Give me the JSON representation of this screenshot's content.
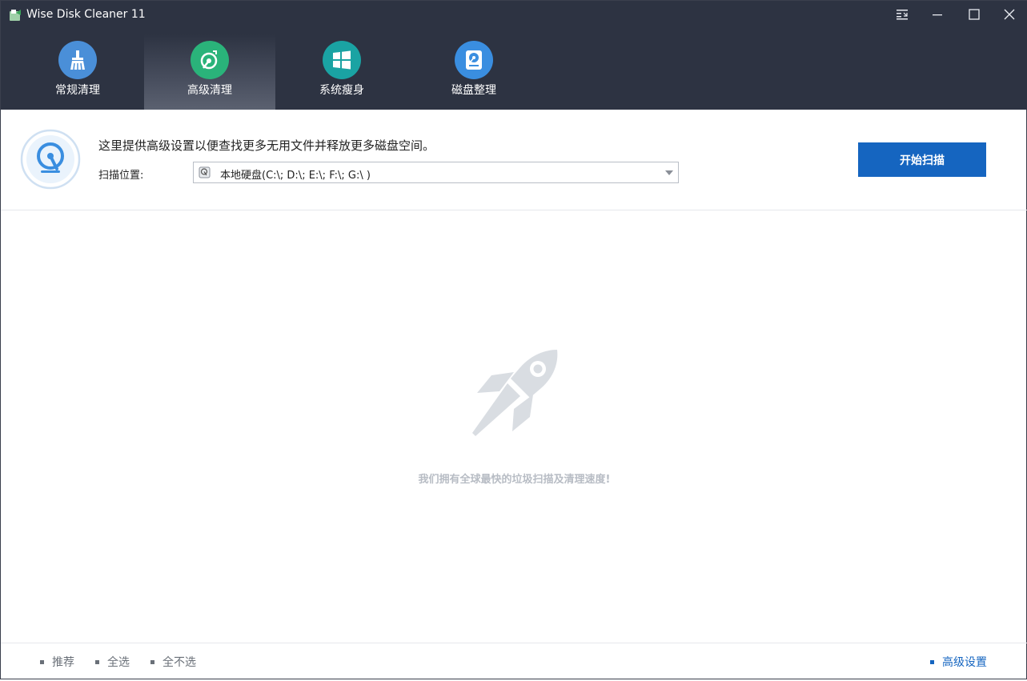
{
  "window": {
    "title": "Wise Disk Cleaner 11"
  },
  "tabs": [
    {
      "label": "常规清理",
      "icon": "broom-icon",
      "color": "#4a8fd8"
    },
    {
      "label": "高级清理",
      "icon": "disk-clean-icon",
      "color": "#2ab37a"
    },
    {
      "label": "系统瘦身",
      "icon": "windows-icon",
      "color": "#1aa3a3"
    },
    {
      "label": "磁盘整理",
      "icon": "disk-defrag-icon",
      "color": "#3a8ee0"
    }
  ],
  "active_tab": "高级清理",
  "info": {
    "description": "这里提供高级设置以便查找更多无用文件并释放更多磁盘空间。",
    "location_label": "扫描位置:",
    "location_value": "本地硬盘(C:\\; D:\\; E:\\; F:\\; G:\\ )"
  },
  "scan_button": "开始扫描",
  "main": {
    "slogan": "我们拥有全球最快的垃圾扫描及清理速度!"
  },
  "footer": {
    "recommend": "推荐",
    "select_all": "全选",
    "select_none": "全不选",
    "advanced_settings": "高级设置"
  },
  "colors": {
    "header_bg": "#2d3342",
    "accent": "#1565c0"
  }
}
